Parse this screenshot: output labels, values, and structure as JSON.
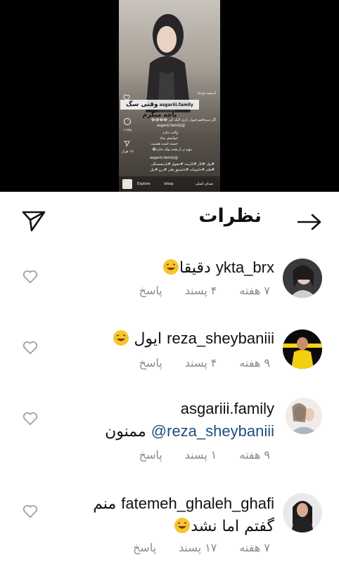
{
  "video": {
    "audio_label": "اندیشه اوجدا",
    "banner": "وقتی سگ پاچه میگرم",
    "account": "asgariii.family",
    "caption_line1": "اگر سرفاصو فیول داری لایک کن 😂😂😂😂",
    "caption_user": "@asgariii.family",
    "lines": [
      "والت ندارد",
      "خوابیش میاد",
      "خسته است همینت",
      "مهم تر از همه یوام ندارد😂"
    ],
    "tagged": "@asgariii.family",
    "hashtags1": "#یول #کار #کارمند #حقوق #بازنشستگی",
    "hashtags2": "#طنز #خانومانه #نانستیع_طنز #زرو #بیل",
    "like_count": "۱٬۲۳۸",
    "share_count": "۱۷۰ هزار",
    "bottom_explore": "Explore",
    "bottom_shop": "ishop",
    "bottom_audio": "صدای اصلی"
  },
  "header": {
    "title": "نظرات"
  },
  "comments": [
    {
      "username": "ykta_brx",
      "text": "دقیقا",
      "emoji": "😂",
      "age": "۷ هفته",
      "likes": "۴ پسند",
      "reply": "پاسخ"
    },
    {
      "username": "reza_sheybaniii",
      "text": "ایول",
      "emoji": "😂",
      "age": "۹ هفته",
      "likes": "۴ پسند",
      "reply": "پاسخ"
    },
    {
      "username": "asgariii.family",
      "mention": "@reza_sheybaniii",
      "text": "ممنون",
      "age": "۹ هفته",
      "likes": "۱ پسند",
      "reply": "پاسخ"
    },
    {
      "username": "fatemeh_ghaleh_ghafi",
      "text_line1": "منم",
      "text_line2": "گفتم اما نشد",
      "emoji": "😂",
      "age": "۷ هفته",
      "likes": "۱۷ پسند",
      "reply": "پاسخ"
    }
  ],
  "colors": {
    "text": "#111111",
    "meta": "#8a8a8a",
    "mention": "#1f4e7a",
    "background": "#ffffff"
  }
}
